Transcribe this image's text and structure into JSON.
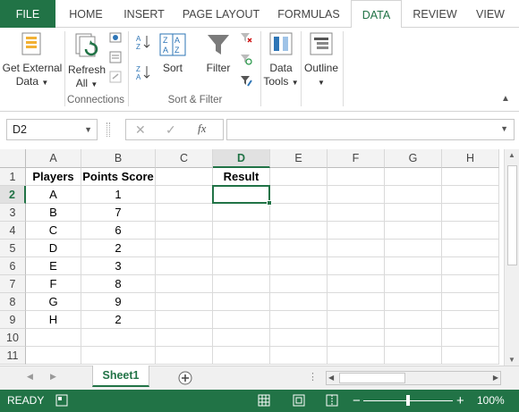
{
  "tabs": [
    "FILE",
    "HOME",
    "INSERT",
    "PAGE LAYOUT",
    "FORMULAS",
    "DATA",
    "REVIEW",
    "VIEW"
  ],
  "active_tab": "DATA",
  "ribbon": {
    "get_external_line1": "Get External",
    "get_external_line2": "Data",
    "refresh_line1": "Refresh",
    "refresh_line2": "All",
    "connections_label": "Connections",
    "sort_label": "Sort",
    "filter_label": "Filter",
    "sort_filter_label": "Sort & Filter",
    "data_tools_line1": "Data",
    "data_tools_line2": "Tools",
    "outline_label": "Outline",
    "az": "A Z",
    "za": "Z A"
  },
  "formula_bar": {
    "name_box": "D2",
    "fx": "fx",
    "formula": ""
  },
  "columns": [
    "A",
    "B",
    "C",
    "D",
    "E",
    "F",
    "G",
    "H"
  ],
  "selected_column": "D",
  "rows": [
    "1",
    "2",
    "3",
    "4",
    "5",
    "6",
    "7",
    "8",
    "9",
    "10",
    "11"
  ],
  "selected_row": "2",
  "cells": {
    "headers": {
      "A": "Players",
      "B": "Points Score",
      "D": "Result"
    },
    "players": [
      "A",
      "B",
      "C",
      "D",
      "E",
      "F",
      "G",
      "H"
    ],
    "scores": [
      "1",
      "7",
      "6",
      "2",
      "3",
      "8",
      "9",
      "2"
    ]
  },
  "sheet_tab": "Sheet1",
  "status": {
    "ready": "READY",
    "zoom": "100%"
  },
  "colors": {
    "accent": "#217346"
  }
}
